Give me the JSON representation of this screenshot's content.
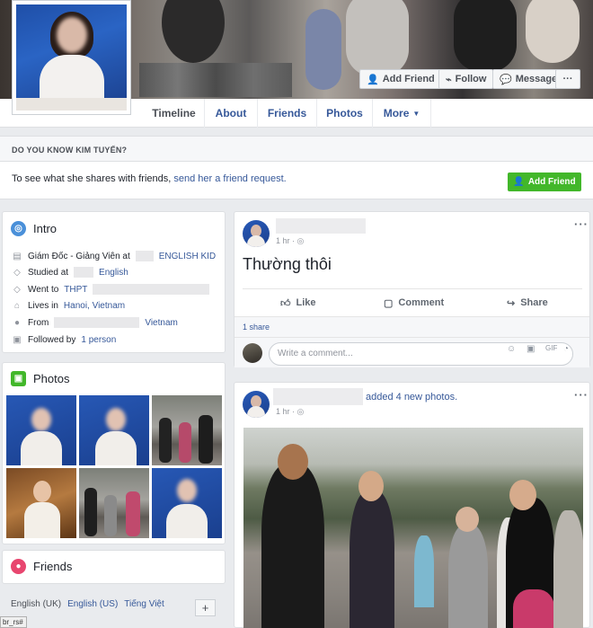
{
  "cover_buttons": {
    "add_friend": "Add Friend",
    "follow": "Follow",
    "message": "Message",
    "more": "···"
  },
  "nav": {
    "tabs": [
      "Timeline",
      "About",
      "Friends",
      "Photos",
      "More"
    ],
    "active": "Timeline"
  },
  "know": {
    "heading": "DO YOU KNOW KIM TUYẾN?",
    "text_before": "To see what she shares with friends,",
    "link": "send her a friend request.",
    "button": "Add Friend"
  },
  "intro": {
    "title": "Intro",
    "rows": [
      {
        "icon": "briefcase-icon",
        "text": "Giám Đốc - Giảng Viên at",
        "link": "ENGLISH KID"
      },
      {
        "icon": "graduation-cap-icon",
        "text": "Studied at",
        "link": "English"
      },
      {
        "icon": "graduation-cap-icon",
        "text": "Went to",
        "link": "THPT"
      },
      {
        "icon": "home-icon",
        "text": "Lives in",
        "link": "Hanoi, Vietnam"
      },
      {
        "icon": "location-pin-icon",
        "text": "From",
        "link": "Vietnam"
      },
      {
        "icon": "followers-icon",
        "text": "Followed by",
        "link": "1 person"
      }
    ]
  },
  "photos": {
    "title": "Photos"
  },
  "friends": {
    "title": "Friends"
  },
  "footer": {
    "languages": [
      "English (UK)",
      "English (US)",
      "Tiếng Việt"
    ],
    "plus": "+",
    "status_text": "br_rs#"
  },
  "post1": {
    "time": "1 hr",
    "text": "Thường thôi",
    "actions": [
      "Like",
      "Comment",
      "Share"
    ],
    "shares": "1 share",
    "comment_placeholder": "Write a comment..."
  },
  "post2": {
    "action_text": "added 4 new photos.",
    "time": "1 hr"
  },
  "colors": {
    "facebook_blue": "#365899",
    "add_friend_green": "#42b72a",
    "intro_icon": "#4a90d9",
    "photos_icon": "#42b72a",
    "friends_icon": "#e8466f"
  }
}
